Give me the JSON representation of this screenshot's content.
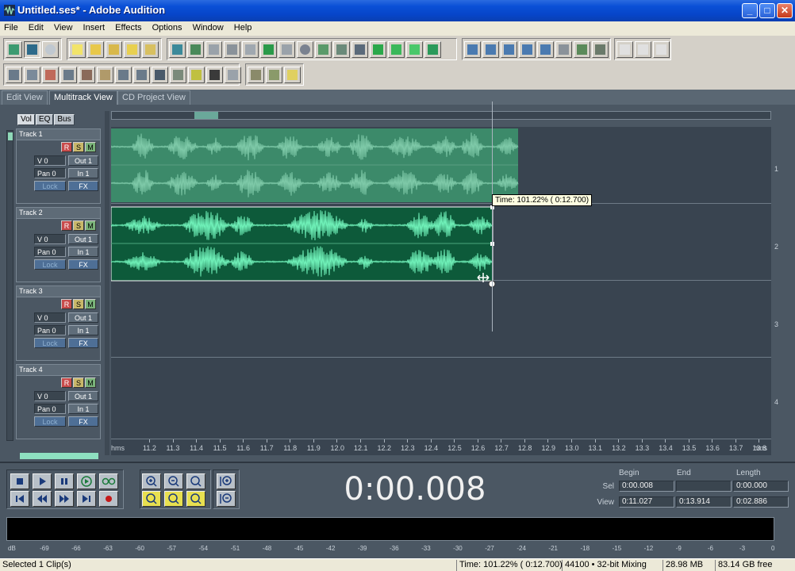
{
  "window": {
    "title": "Untitled.ses* - Adobe Audition",
    "controls": {
      "minimize": "_",
      "maximize": "□",
      "close": "✕"
    }
  },
  "menu": [
    "File",
    "Edit",
    "View",
    "Insert",
    "Effects",
    "Options",
    "Window",
    "Help"
  ],
  "view_tabs": [
    {
      "label": "Edit View",
      "active": false
    },
    {
      "label": "Multitrack View",
      "active": true
    },
    {
      "label": "CD Project View",
      "active": false
    }
  ],
  "track_panel_tabs": [
    "Vol",
    "EQ",
    "Bus"
  ],
  "tracks": [
    {
      "name": "Track 1",
      "record": "R",
      "solo": "S",
      "mute": "M",
      "volume": "V 0",
      "output": "Out 1",
      "pan": "Pan 0",
      "input": "In 1",
      "lock": "Lock",
      "fx": "FX",
      "lane_number": "1"
    },
    {
      "name": "Track 2",
      "record": "R",
      "solo": "S",
      "mute": "M",
      "volume": "V 0",
      "output": "Out 1",
      "pan": "Pan 0",
      "input": "In 1",
      "lock": "Lock",
      "fx": "FX",
      "lane_number": "2"
    },
    {
      "name": "Track 3",
      "record": "R",
      "solo": "S",
      "mute": "M",
      "volume": "V 0",
      "output": "Out 1",
      "pan": "Pan 0",
      "input": "In 1",
      "lock": "Lock",
      "fx": "FX",
      "lane_number": "3"
    },
    {
      "name": "Track 4",
      "record": "R",
      "solo": "S",
      "mute": "M",
      "volume": "V 0",
      "output": "Out 1",
      "pan": "Pan 0",
      "input": "In 1",
      "lock": "Lock",
      "fx": "FX",
      "lane_number": "4"
    }
  ],
  "timeline": {
    "ruler_labels": [
      "hms",
      "11.2",
      "11.3",
      "11.4",
      "11.5",
      "11.6",
      "11.7",
      "11.8",
      "11.9",
      "12.0",
      "12.1",
      "12.2",
      "12.3",
      "12.4",
      "12.5",
      "12.6",
      "12.7",
      "12.8",
      "12.9",
      "13.0",
      "13.1",
      "13.2",
      "13.3",
      "13.4",
      "13.5",
      "13.6",
      "13.7",
      "13.8",
      "hms"
    ],
    "tooltip": "Time: 101.22% ( 0:12.700)",
    "clip_colors": {
      "track1": "#3c8a6a",
      "track2": "#0d5a3a",
      "wave1": "#7ec9a8",
      "wave2": "#6ff0b8"
    }
  },
  "transport": {
    "buttons": [
      "stop",
      "play",
      "pause",
      "play-from-cursor",
      "loop",
      "go-to-start",
      "rewind",
      "fast-forward",
      "go-to-end",
      "record"
    ],
    "time": "0:00.008"
  },
  "selection_view": {
    "headers": [
      "Begin",
      "End",
      "Length"
    ],
    "sel_label": "Sel",
    "view_label": "View",
    "sel": {
      "begin": "0:00.008",
      "end": "",
      "length": "0:00.000"
    },
    "view": {
      "begin": "0:11.027",
      "end": "0:13.914",
      "length": "0:02.886"
    }
  },
  "level_meter": {
    "scale": [
      "dB",
      "-69",
      "-66",
      "-63",
      "-60",
      "-57",
      "-54",
      "-51",
      "-48",
      "-45",
      "-42",
      "-39",
      "-36",
      "-33",
      "-30",
      "-27",
      "-24",
      "-21",
      "-18",
      "-15",
      "-12",
      "-9",
      "-6",
      "-3",
      "0"
    ]
  },
  "status": {
    "left": "Selected 1 Clip(s)",
    "time": "Time: 101.22% ( 0:12.700)",
    "format": "44100 • 32-bit Mixing",
    "memory": "28.98 MB",
    "disk": "83.14 GB free"
  }
}
